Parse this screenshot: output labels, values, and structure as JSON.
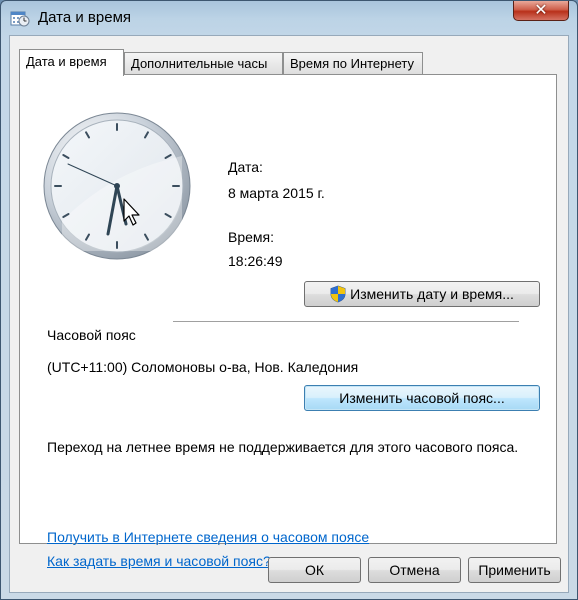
{
  "window": {
    "title": "Дата и время",
    "close_glyph": "✕"
  },
  "tabs": [
    {
      "label": "Дата и время",
      "active": true
    },
    {
      "label": "Дополнительные часы",
      "active": false
    },
    {
      "label": "Время по Интернету",
      "active": false
    }
  ],
  "datetime": {
    "date_label": "Дата:",
    "date_value": "8 марта 2015 г.",
    "time_label": "Время:",
    "time_value": "18:26:49",
    "change_datetime_button": "Изменить дату и время..."
  },
  "timezone": {
    "section_label": "Часовой пояс",
    "value": "(UTC+11:00) Соломоновы о-ва, Нов. Каледония",
    "change_timezone_button": "Изменить часовой пояс...",
    "dst_note": "Переход на летнее время не поддерживается для этого часового пояса."
  },
  "links": {
    "timezone_info": "Получить в Интернете сведения о часовом поясе",
    "how_to_set": "Как задать время и часовой пояс?"
  },
  "footer": {
    "ok": "ОК",
    "cancel": "Отмена",
    "apply": "Применить"
  },
  "colors": {
    "link": "#0066cc",
    "focused_button_border": "#3c7fb1"
  },
  "icons": {
    "title": "date-time-icon",
    "close": "close-icon",
    "uac_shield": "uac-shield-icon",
    "clock": "analog-clock",
    "cursor": "mouse-pointer-icon"
  }
}
